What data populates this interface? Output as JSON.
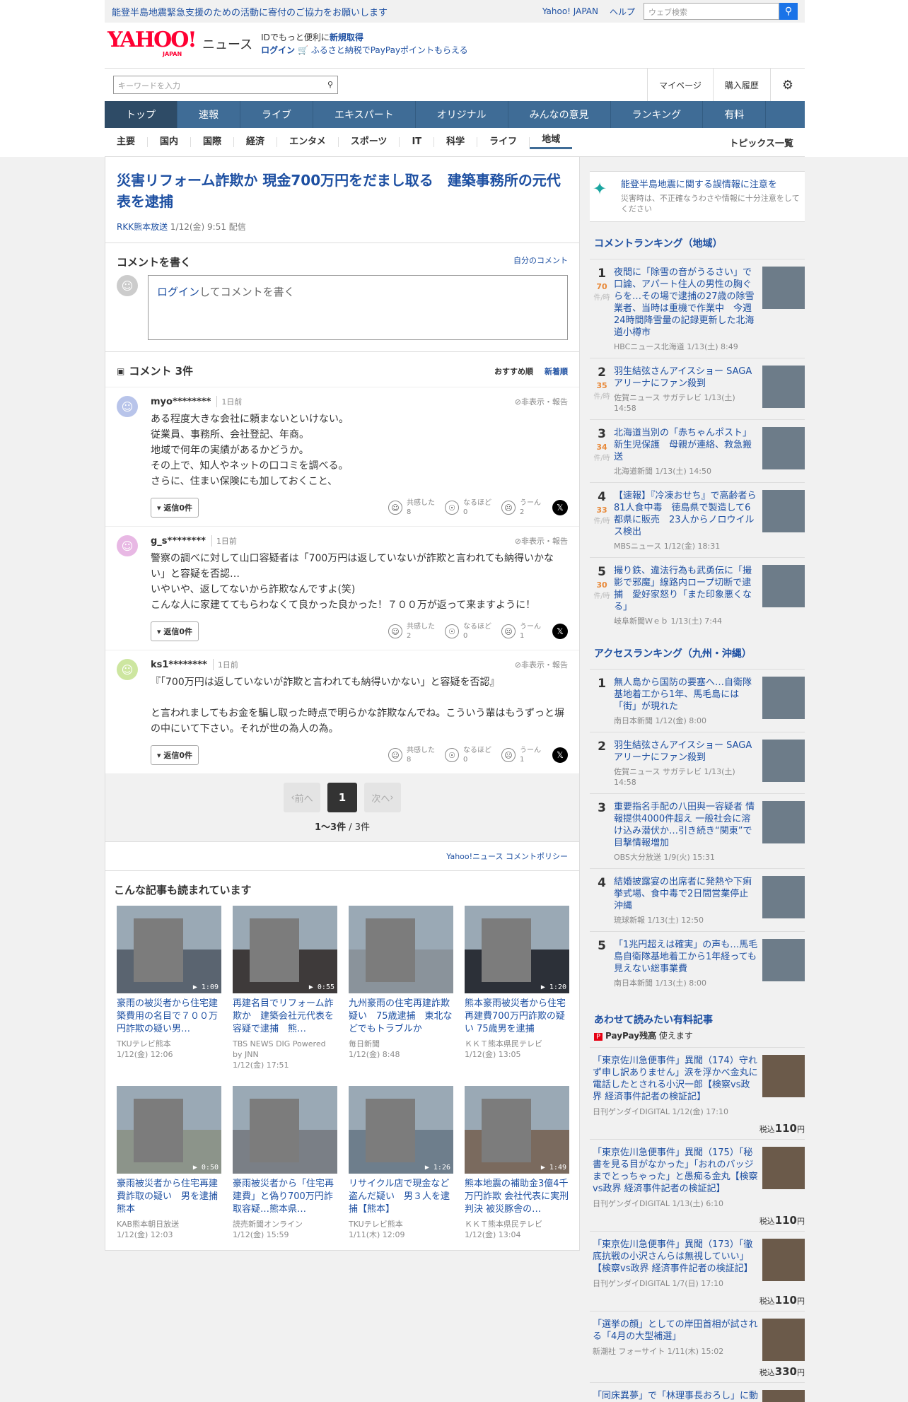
{
  "topbar": {
    "notice": "能登半島地震緊急支援のための活動に寄付のご協力をお願いします",
    "links": [
      "Yahoo! JAPAN",
      "ヘルプ"
    ],
    "search_placeholder": "ウェブ検索"
  },
  "header": {
    "logo": "YAHOO!",
    "logo_sub": "JAPAN",
    "brand": "ニュース",
    "line1_prefix": "IDでもっと便利に",
    "line1_link": "新規取得",
    "login": "ログイン",
    "furusato": "ふるさと納税でPayPayポイントもらえる"
  },
  "searchbar": {
    "placeholder": "キーワードを入力",
    "mypage": "マイページ",
    "history": "購入履歴"
  },
  "nav": [
    "トップ",
    "速報",
    "ライブ",
    "エキスパート",
    "オリジナル",
    "みんなの意見",
    "ランキング",
    "有料"
  ],
  "subnav": [
    "主要",
    "国内",
    "国際",
    "経済",
    "エンタメ",
    "スポーツ",
    "IT",
    "科学",
    "ライフ",
    "地域"
  ],
  "subnav_right": "トピックス一覧",
  "article": {
    "title": "災害リフォーム詐欺か 現金700万円をだまし取る　建築事務所の元代表を逮捕",
    "source": "RKK熊本放送",
    "date": "1/12(金) 9:51 配信"
  },
  "write": {
    "heading": "コメントを書く",
    "my_comments": "自分のコメント",
    "login": "ログイン",
    "placeholder_rest": "してコメントを書く"
  },
  "comments_header": {
    "title": "コメント 3件",
    "sort_recommended": "おすすめ順",
    "sort_new": "新着順"
  },
  "comments": [
    {
      "user": "myo********",
      "ago": "1日前",
      "report": "非表示・報告",
      "text": "ある程度大きな会社に頼まないといけない。\n従業員、事務所、会社登記、年商。\n地域で何年の実績があるかどうか。\nその上で、知人やネットの口コミを調べる。\nさらに、住まい保険にも加しておくこと、",
      "replies": "返信0件",
      "reactions": [
        {
          "label": "共感した",
          "count": "8"
        },
        {
          "label": "なるほど",
          "count": "0"
        },
        {
          "label": "うーん",
          "count": "2"
        }
      ],
      "avatar_color": "#b8c4ea"
    },
    {
      "user": "g_s********",
      "ago": "1日前",
      "report": "非表示・報告",
      "text": "警察の調べに対して山口容疑者は「700万円は返していないが詐欺と言われても納得いかない」と容疑を否認…\nいやいや、返してないから詐欺なんですよ(笑)\nこんな人に家建ててもらわなくて良かった良かった！７００万が返って来ますように！",
      "replies": "返信0件",
      "reactions": [
        {
          "label": "共感した",
          "count": "2"
        },
        {
          "label": "なるほど",
          "count": "0"
        },
        {
          "label": "うーん",
          "count": "1"
        }
      ],
      "avatar_color": "#e8b8e4"
    },
    {
      "user": "ks1********",
      "ago": "1日前",
      "report": "非表示・報告",
      "text": "『「700万円は返していないが詐欺と言われても納得いかない」と容疑を否認』\n\nと言われましてもお金を騙し取った時点で明らかな詐欺なんでね。こういう輩はもうずっと塀の中にいて下さい。それが世の為人の為。",
      "replies": "返信0件",
      "reactions": [
        {
          "label": "共感した",
          "count": "8"
        },
        {
          "label": "なるほど",
          "count": "0"
        },
        {
          "label": "うーん",
          "count": "1"
        }
      ],
      "avatar_color": "#cde6a0"
    }
  ],
  "pager": {
    "prev": "前へ",
    "current": "1",
    "next": "次へ",
    "count": "1〜3件",
    "total": " / 3件"
  },
  "policy": "Yahoo!ニュース コメントポリシー",
  "related": {
    "heading": "こんな記事も読まれています",
    "items": [
      {
        "title": "豪雨の被災者から住宅建築費用の名目で７００万円詐欺の疑い男…",
        "source": "TKUテレビ熊本",
        "date": "1/12(金) 12:06",
        "dur": "1:09"
      },
      {
        "title": "再建名目でリフォーム詐欺か　建築会社元代表を容疑で逮捕　熊…",
        "source": "TBS NEWS DIG Powered by JNN",
        "date": "1/12(金) 17:51",
        "dur": "0:55"
      },
      {
        "title": "九州豪雨の住宅再建詐欺疑い　75歳逮捕　東北などでもトラブルか",
        "source": "毎日新聞",
        "date": "1/12(金) 8:48",
        "dur": ""
      },
      {
        "title": "熊本豪雨被災者から住宅再建費700万円詐欺の疑い 75歳男を逮捕",
        "source": "ＫＫＴ熊本県民テレビ",
        "date": "1/12(金) 13:05",
        "dur": "1:20"
      },
      {
        "title": "豪雨被災者から住宅再建費詐取の疑い　男を逮捕　熊本",
        "source": "KAB熊本朝日放送",
        "date": "1/12(金) 12:03",
        "dur": "0:50"
      },
      {
        "title": "豪雨被災者から「住宅再建費」と偽り700万円詐取容疑…熊本県…",
        "source": "読売新聞オンライン",
        "date": "1/12(金) 15:59",
        "dur": ""
      },
      {
        "title": "リサイクル店で現金など盗んだ疑い　男３人を逮捕【熊本】",
        "source": "TKUテレビ熊本",
        "date": "1/11(木) 12:09",
        "dur": "1:26"
      },
      {
        "title": "熊本地震の補助金3億4千万円詐欺 会社代表に実刑判決 被災豚舎の…",
        "source": "ＫＫＴ熊本県民テレビ",
        "date": "1/12(金) 13:04",
        "dur": "1:49"
      }
    ]
  },
  "side": {
    "warn_title": "能登半島地震に関する誤情報に注意を",
    "warn_sub": "災害時は、不正確なうわさや情報に十分注意をしてください",
    "comment_ranking_title": "コメントランキング（地域）",
    "comment_ranking": [
      {
        "rank": "1",
        "count": "70",
        "unit": "件/時",
        "title": "夜間に「除雪の音がうるさい」で口論、アパート住人の男性の胸ぐらを…その場で逮捕の27歳の除雪業者、当時は重機で作業中　今週24時間降雪量の記録更新した北海道小樽市",
        "meta": "HBCニュース北海道 1/13(土) 8:49"
      },
      {
        "rank": "2",
        "count": "35",
        "unit": "件/時",
        "title": "羽生結弦さんアイスショー SAGAアリーナにファン殺到",
        "meta": "佐賀ニュース サガテレビ 1/13(土) 14:58"
      },
      {
        "rank": "3",
        "count": "34",
        "unit": "件/時",
        "title": "北海道当別の「赤ちゃんポスト」新生児保護　母親が連絡、救急搬送",
        "meta": "北海道新聞 1/13(土) 14:50"
      },
      {
        "rank": "4",
        "count": "33",
        "unit": "件/時",
        "title": "【速報】『冷凍おせち』で高齢者ら81人食中毒　徳島県で製造して6都県に販売　23人からノロウイルス検出",
        "meta": "MBSニュース 1/12(金) 18:31"
      },
      {
        "rank": "5",
        "count": "30",
        "unit": "件/時",
        "title": "撮り鉄、違法行為も武勇伝に「撮影で邪魔」線路内ロープ切断で逮捕　愛好家怒り「また印象悪くなる」",
        "meta": "岐阜新聞Ｗｅｂ 1/13(土) 7:44"
      }
    ],
    "access_ranking_title": "アクセスランキング（九州・沖縄）",
    "access_ranking": [
      {
        "rank": "1",
        "title": "無人島から国防の要塞へ…自衛隊基地着工から1年、馬毛島には「街」が現れた",
        "meta": "南日本新聞 1/12(金) 8:00"
      },
      {
        "rank": "2",
        "title": "羽生結弦さんアイスショー SAGAアリーナにファン殺到",
        "meta": "佐賀ニュース サガテレビ 1/13(土) 14:58"
      },
      {
        "rank": "3",
        "title": "重要指名手配の八田與一容疑者 情報提供4000件超え 一般社会に溶け込み潜伏か…引き続き“関東”で目撃情報増加",
        "meta": "OBS大分放送 1/9(火) 15:31"
      },
      {
        "rank": "4",
        "title": "結婚披露宴の出席者に発熱や下痢 挙式場、食中毒で2日間営業停止 沖縄",
        "meta": "琉球新報 1/13(土) 12:50"
      },
      {
        "rank": "5",
        "title": "「1兆円超えは確実」の声も…馬毛島自衛隊基地着工から1年経っても見えない総事業費",
        "meta": "南日本新聞 1/13(土) 8:00"
      }
    ],
    "paid_title": "あわせて読みたい有料記事",
    "paypay": "PayPay残高",
    "paypay_suffix": "使えます",
    "paid": [
      {
        "title": "「東京佐川急便事件」異聞（174）守れず申し訳ありません」涙を浮かべ金丸に電話したとされる小沢一郎【検察vs政界 経済事件記者の検証記】",
        "meta": "日刊ゲンダイDIGITAL 1/12(金) 17:10",
        "price_prefix": "税込",
        "price": "110",
        "price_unit": "円"
      },
      {
        "title": "「東京佐川急便事件」異聞（175）「秘書を見る目がなかった」「おれのバッジまでとっちゃった」と愚痴る金丸【検察vs政界 経済事件記者の検証記】",
        "meta": "日刊ゲンダイDIGITAL 1/13(土) 6:10",
        "price_prefix": "税込",
        "price": "110",
        "price_unit": "円"
      },
      {
        "title": "「東京佐川急便事件」異聞（173）「徹底抗戦の小沢さんらは無視していい」【検察vs政界 経済事件記者の検証記】",
        "meta": "日刊ゲンダイDIGITAL 1/7(日) 17:10",
        "price_prefix": "税込",
        "price": "110",
        "price_unit": "円"
      },
      {
        "title": "「選挙の顔」としての岸田首相が試される「4月の大型補選」",
        "meta": "新潮社 フォーサイト 1/11(木) 15:02",
        "price_prefix": "税込",
        "price": "330",
        "price_unit": "円"
      },
      {
        "title": "「同床異夢」で「林理事長おろし」に動く日大の魑魅魍魎",
        "meta": "",
        "price_prefix": "",
        "price": "",
        "price_unit": ""
      }
    ]
  }
}
